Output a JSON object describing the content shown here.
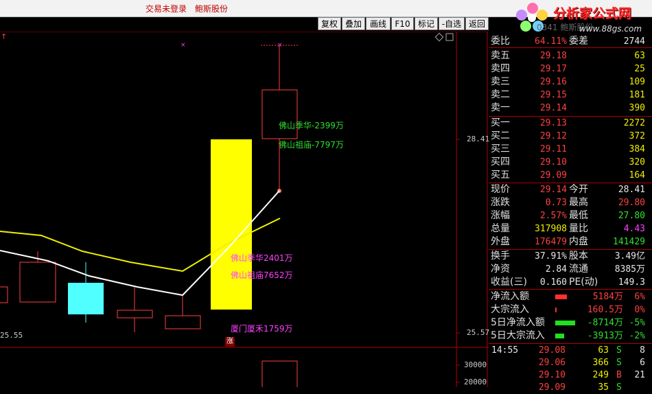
{
  "topbar": {
    "login_status": "交易未登录",
    "stock_name": "鲍斯股份"
  },
  "logo": {
    "title": "分析家公式网",
    "url_text": "www.88gs.com",
    "overlap_text": "0341 鲍斯股份"
  },
  "toolbar": {
    "items": [
      "复权",
      "叠加",
      "画线",
      "F10",
      "标记",
      "-自选",
      "返回"
    ]
  },
  "chart": {
    "price_labels": [
      "28.41",
      "25.57",
      "25.55"
    ],
    "volume_labels": [
      "30000",
      "20000"
    ],
    "zhang_label": "涨",
    "notes_green": [
      "佛山季华-2399万",
      "佛山祖庙-7797万"
    ],
    "notes_magenta": [
      "佛山季华2401万",
      "佛山祖庙7652万",
      "厦门厦禾1759万"
    ]
  },
  "quote": {
    "weibi": {
      "label": "委比",
      "value": "64.11%",
      "label2": "委差",
      "value2": "2744"
    },
    "asks": [
      {
        "label": "卖五",
        "price": "29.18",
        "vol": "63"
      },
      {
        "label": "卖四",
        "price": "29.17",
        "vol": "25"
      },
      {
        "label": "卖三",
        "price": "29.16",
        "vol": "109"
      },
      {
        "label": "卖二",
        "price": "29.15",
        "vol": "181"
      },
      {
        "label": "卖一",
        "price": "29.14",
        "vol": "390"
      }
    ],
    "bids": [
      {
        "label": "买一",
        "price": "29.13",
        "vol": "2272"
      },
      {
        "label": "买二",
        "price": "29.12",
        "vol": "372"
      },
      {
        "label": "买三",
        "price": "29.11",
        "vol": "384"
      },
      {
        "label": "买四",
        "price": "29.10",
        "vol": "320"
      },
      {
        "label": "买五",
        "price": "29.09",
        "vol": "164"
      }
    ],
    "stats": [
      {
        "l1": "现价",
        "v1": "29.14",
        "c1": "red",
        "l2": "今开",
        "v2": "28.41",
        "c2": "white"
      },
      {
        "l1": "涨跌",
        "v1": "0.73",
        "c1": "red",
        "l2": "最高",
        "v2": "29.80",
        "c2": "red"
      },
      {
        "l1": "涨幅",
        "v1": "2.57%",
        "c1": "red",
        "l2": "最低",
        "v2": "27.80",
        "c2": "green"
      },
      {
        "l1": "总量",
        "v1": "317908",
        "c1": "yellow",
        "l2": "量比",
        "v2": "4.43",
        "c2": "mag"
      },
      {
        "l1": "外盘",
        "v1": "176479",
        "c1": "red",
        "l2": "内盘",
        "v2": "141429",
        "c2": "green"
      }
    ],
    "fundamentals": [
      {
        "l1": "换手",
        "v1": "37.91%",
        "l2": "股本",
        "v2": "3.49亿"
      },
      {
        "l1": "净资",
        "v1": "2.84",
        "l2": "流通",
        "v2": "8385万"
      },
      {
        "l1": "收益(三)",
        "v1": "0.160",
        "l2": "PE(动)",
        "v2": "149.3"
      }
    ],
    "flows": [
      {
        "label": "净流入额",
        "value": "5184万",
        "pct": "6%",
        "color": "red",
        "bar_color": "#ff3030",
        "bar_fraction": 0.19
      },
      {
        "label": "大宗流入",
        "value": "160.5万",
        "pct": "0%",
        "color": "red",
        "bar_color": "#ff3030",
        "bar_fraction": 0.01
      },
      {
        "label": "5日净流入额",
        "value": "-8714万",
        "pct": "-5%",
        "color": "green",
        "bar_color": "#20e020",
        "bar_fraction": 0.32
      },
      {
        "label": "5日大宗流入",
        "value": "-3913万",
        "pct": "-2%",
        "color": "green",
        "bar_color": "#20e020",
        "bar_fraction": 0.14
      }
    ],
    "ticks": [
      {
        "time": "14:55",
        "price": "29.08",
        "vol": "63",
        "side": "S",
        "side_color": "green",
        "n": "8"
      },
      {
        "time": "",
        "price": "29.06",
        "vol": "366",
        "side": "S",
        "side_color": "green",
        "n": "6"
      },
      {
        "time": "",
        "price": "29.10",
        "vol": "249",
        "side": "B",
        "side_color": "red",
        "n": "21"
      },
      {
        "time": "",
        "price": "29.09",
        "vol": "35",
        "side": "S",
        "side_color": "green",
        "n": ""
      }
    ]
  },
  "colors": {
    "up": "#ff4040",
    "down": "#30e030",
    "ma_white": "#ffffff",
    "ma_yellow": "#f0f000",
    "border": "#b00000"
  }
}
